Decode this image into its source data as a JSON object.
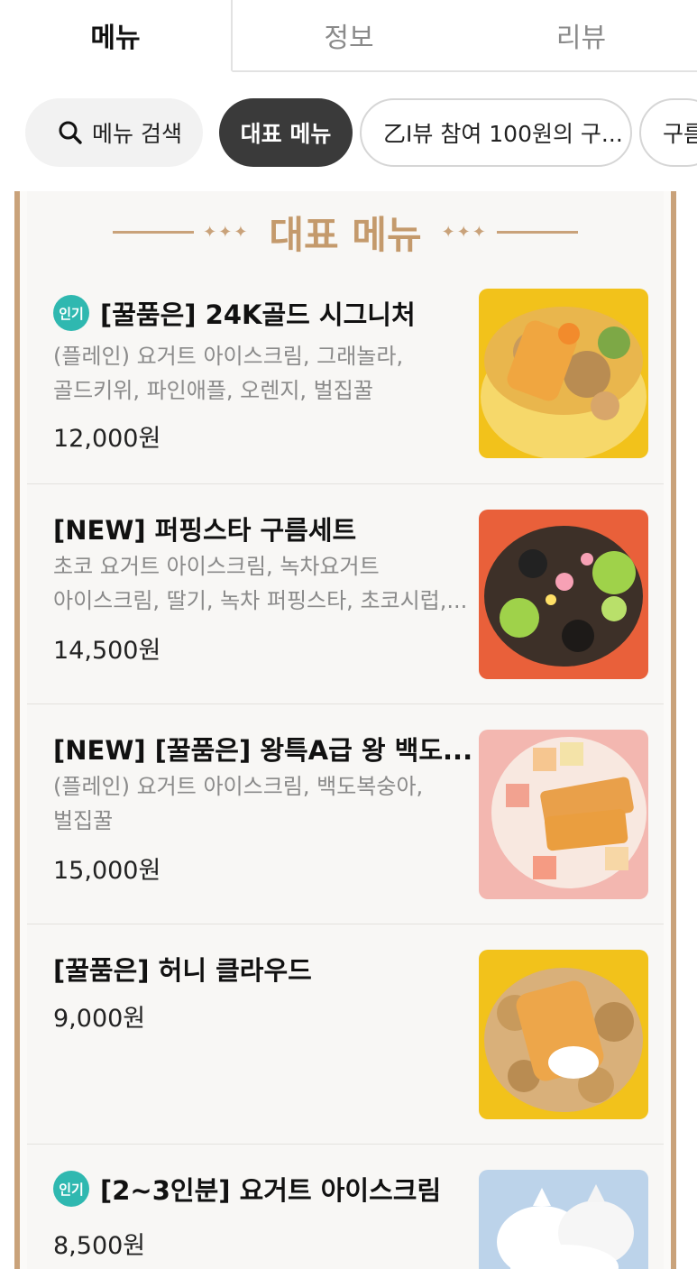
{
  "tabs": [
    {
      "label": "메뉴",
      "active": true
    },
    {
      "label": "정보",
      "active": false
    },
    {
      "label": "리뷰",
      "active": false
    }
  ],
  "chips": {
    "search_label": "메뉴 검색",
    "search_icon": "search-icon",
    "representative": "대표 메뉴",
    "review_event": "乙I뷰 참여 100원의 구...",
    "cloud": "구름"
  },
  "section": {
    "title": "대표 메뉴",
    "accent_color": "#c9a27a"
  },
  "items": [
    {
      "badge": "인기",
      "name": "[꿀품은] 24K골드 시그니처",
      "desc_lines": [
        "(플레인) 요거트 아이스크림, 그래놀라,",
        "골드키위, 파인애플, 오렌지, 벌집꿀"
      ],
      "price": "12,000원"
    },
    {
      "badge": "",
      "name": "[NEW]  퍼핑스타 구름세트",
      "desc_lines": [
        "초코 요거트 아이스크림, 녹차요거트",
        "아이스크림, 딸기, 녹차 퍼핑스타, 초코시럽,..."
      ],
      "price": "14,500원"
    },
    {
      "badge": "",
      "name": "[NEW] [꿀품은] 왕특A급 왕 백도...",
      "desc_lines": [
        "(플레인) 요거트 아이스크림, 백도복숭아,",
        "벌집꿀"
      ],
      "price": "15,000원"
    },
    {
      "badge": "",
      "name": "[꿀품은] 허니 클라우드",
      "desc_lines": [],
      "price": "9,000원"
    },
    {
      "badge": "인기",
      "name": "[2~3인분] 요거트 아이스크림",
      "desc_lines": [],
      "price": "8,500원"
    }
  ]
}
